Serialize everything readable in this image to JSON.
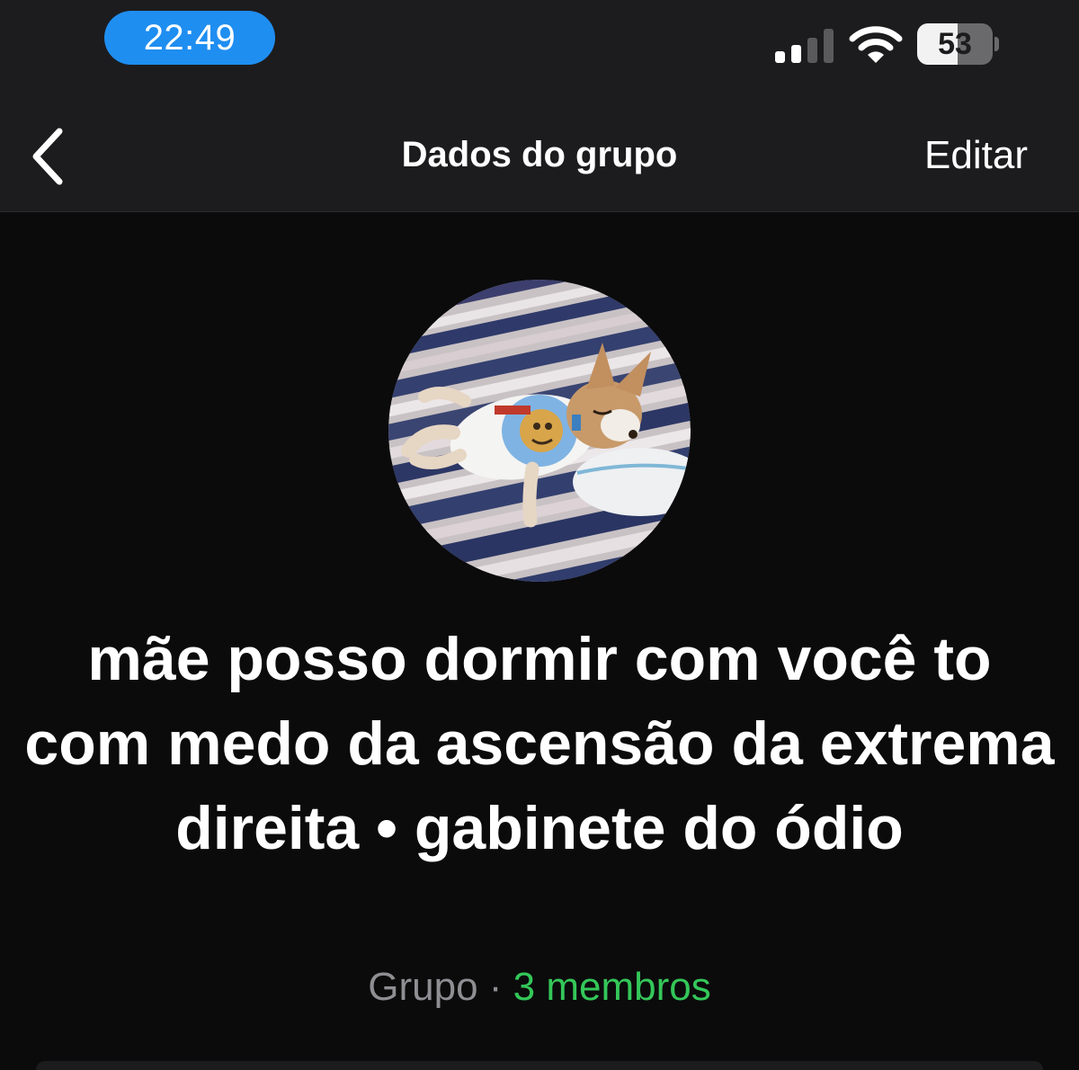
{
  "status_bar": {
    "time": "22:49",
    "signal_bars_active": 2,
    "signal_bars_total": 4,
    "battery_percent": 53,
    "battery_label": "53"
  },
  "nav": {
    "back_icon": "chevron-left-icon",
    "title": "Dados do grupo",
    "edit_label": "Editar"
  },
  "group": {
    "avatar_description_icon": "group-avatar-photo",
    "name": "mãe posso dormir com você to com medo da ascensão da extrema direita • gabinete do ódio",
    "type_label": "Grupo",
    "separator": "·",
    "members_label": "3 membros"
  },
  "colors": {
    "background": "#0b0b0c",
    "bar_background": "#1c1c1e",
    "time_pill": "#1f8ef1",
    "members_accent": "#34c759",
    "secondary_text": "#8e8e93"
  }
}
